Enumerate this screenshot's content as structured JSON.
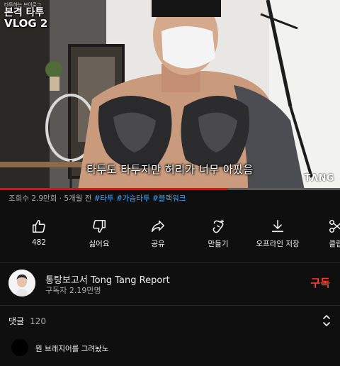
{
  "video": {
    "badge_small": "타투하는 브이로그",
    "badge_line1": "본격 타투",
    "badge_line2": "VLOG 2",
    "subtitle": "타투도 타투지만 허리가 너무 아팠음",
    "watermark": "TΛNG",
    "progress": 0.67
  },
  "meta": {
    "views": "조회수 2.9만회",
    "separator": " · ",
    "age": "5개월 전",
    "hashtags": [
      "#타투",
      "#가슴타투",
      "#블랙워크"
    ]
  },
  "actions": [
    {
      "icon": "thumbs-up-icon",
      "label": "482"
    },
    {
      "icon": "thumbs-down-icon",
      "label": "싫어요"
    },
    {
      "icon": "share-icon",
      "label": "공유"
    },
    {
      "icon": "remix-icon",
      "label": "만들기"
    },
    {
      "icon": "download-icon",
      "label": "오프라인 저장"
    },
    {
      "icon": "clip-icon",
      "label": "클립"
    }
  ],
  "channel": {
    "name": "통탕보고서 Tong Tang Report",
    "subscribers": "구독자 2.19만명",
    "subscribe_label": "구독"
  },
  "comments": {
    "title": "댓글",
    "count": "120",
    "first_comment": "뭔 브래지어를 그려놨노"
  },
  "colors": {
    "background": "#0f0f0f",
    "accent_red": "#ff0000",
    "subscribe_red": "#ff3b30",
    "hashtag_blue": "#3ea6ff",
    "muted_text": "#aaaaaa"
  }
}
